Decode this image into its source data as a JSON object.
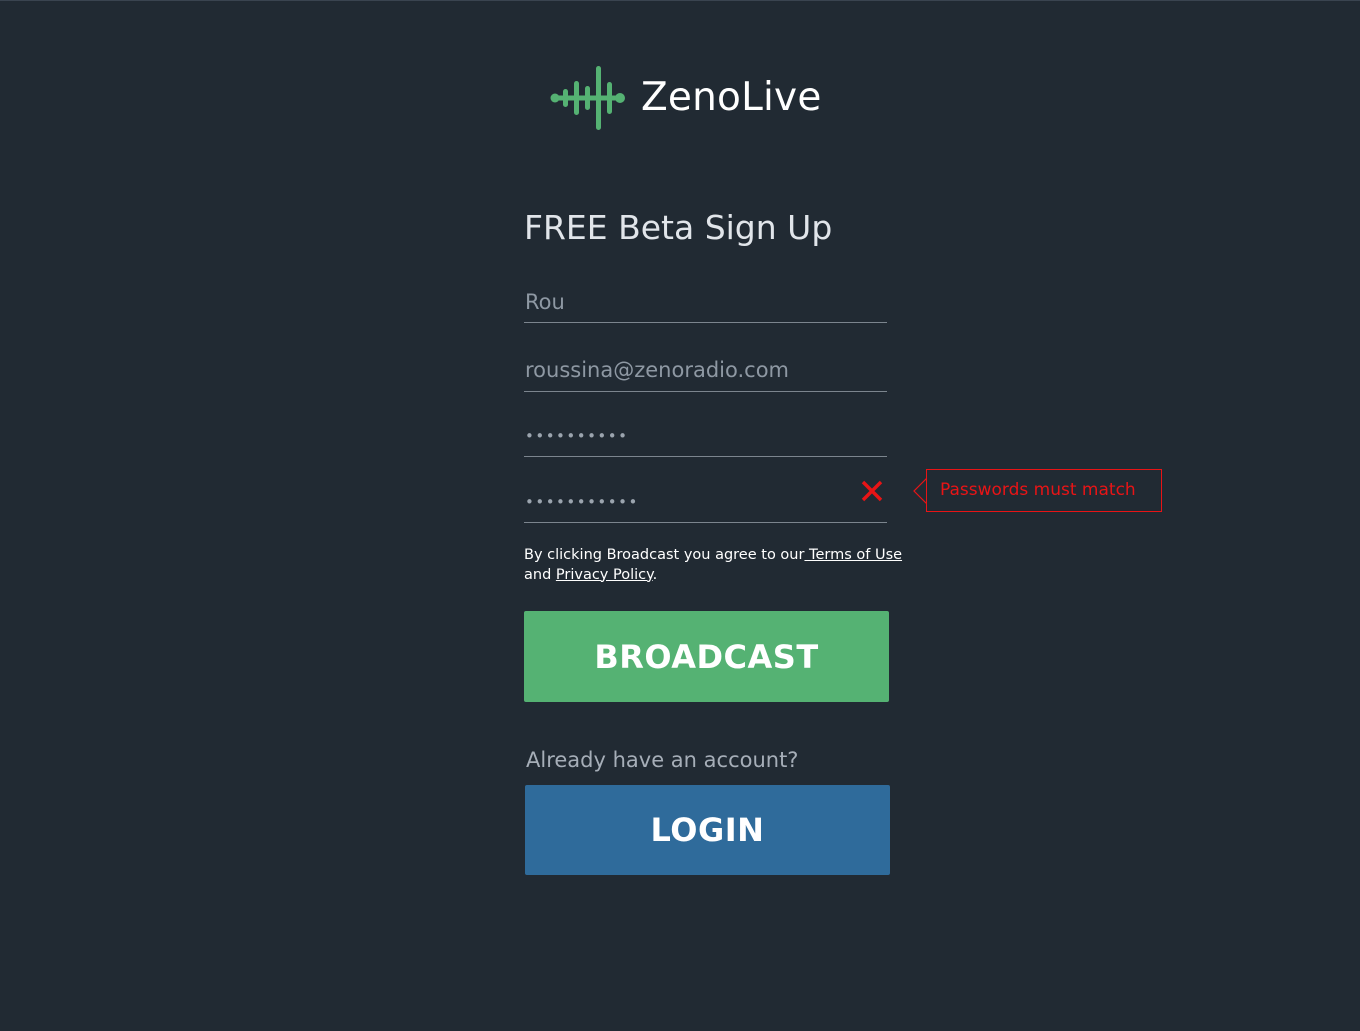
{
  "brand": {
    "name": "ZenoLive",
    "accent_color": "#55b273",
    "icon": "waveform-logo-icon"
  },
  "form": {
    "title": "FREE Beta Sign Up",
    "name_value": "Rou",
    "email_value": "roussina@zenoradio.com",
    "password_value": "••••••••••",
    "confirm_password_value": "•••••••••••",
    "error_icon": "close-icon",
    "error_message": "Passwords must match",
    "error_color": "#e81416"
  },
  "terms": {
    "prefix": "By clicking Broadcast you agree to our",
    "terms_link": " Terms of Use",
    "middle": "and ",
    "privacy_link": "Privacy Policy",
    "suffix": "."
  },
  "actions": {
    "broadcast_label": "BROADCAST",
    "broadcast_color": "#55b273",
    "already_text": "Already have an account?",
    "login_label": "LOGIN",
    "login_color": "#2f6b9b"
  }
}
